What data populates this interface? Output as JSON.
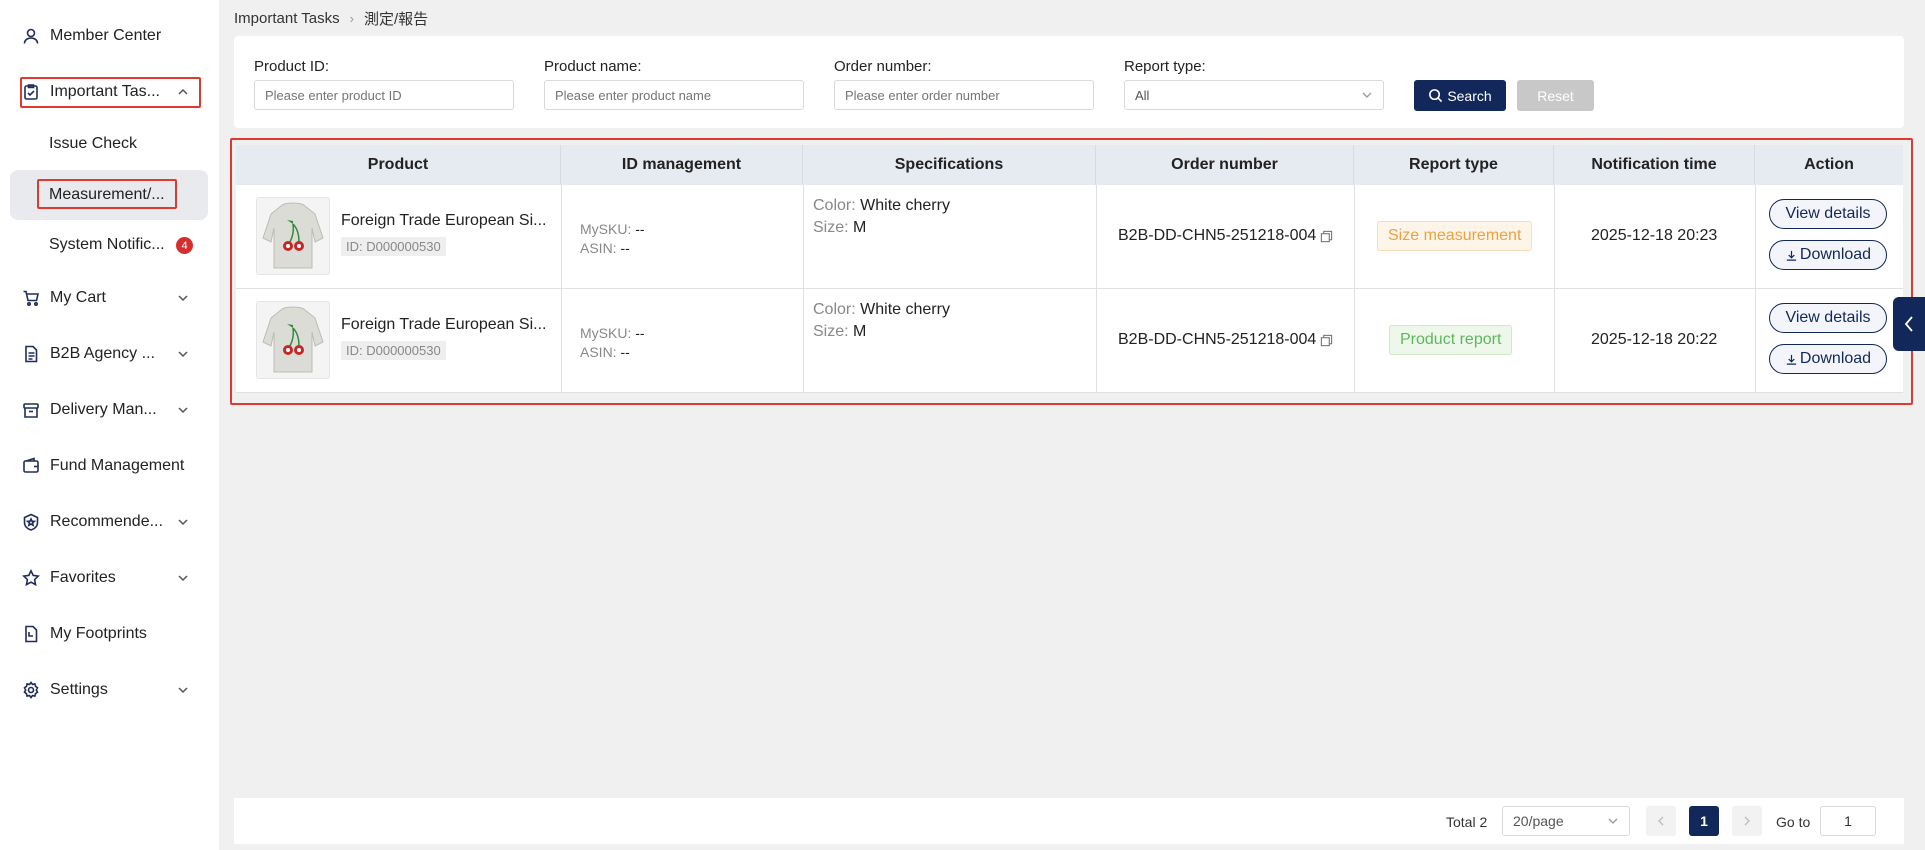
{
  "sidebar": {
    "items": [
      {
        "label": "Member Center",
        "icon": "user-icon"
      },
      {
        "label": "Important Tas...",
        "icon": "clipboard-check-icon"
      },
      {
        "label": "My Cart",
        "icon": "cart-icon"
      },
      {
        "label": "B2B Agency ...",
        "icon": "document-icon"
      },
      {
        "label": "Delivery Man...",
        "icon": "box-icon"
      },
      {
        "label": "Fund Management",
        "icon": "wallet-icon"
      },
      {
        "label": "Recommende...",
        "icon": "shield-star-icon"
      },
      {
        "label": "Favorites",
        "icon": "star-icon"
      },
      {
        "label": "My Footprints",
        "icon": "footprint-icon"
      },
      {
        "label": "Settings",
        "icon": "gear-icon"
      }
    ],
    "sub_items": [
      {
        "label": "Issue Check"
      },
      {
        "label": "Measurement/..."
      },
      {
        "label": "System Notific...",
        "badge": "4"
      }
    ]
  },
  "breadcrumb": {
    "parent": "Important Tasks",
    "current": "測定/報告"
  },
  "filters": {
    "product_id": {
      "label": "Product ID:",
      "placeholder": "Please enter product ID"
    },
    "product_name": {
      "label": "Product name:",
      "placeholder": "Please enter product name"
    },
    "order_number": {
      "label": "Order number:",
      "placeholder": "Please enter order number"
    },
    "report_type": {
      "label": "Report type:",
      "value": "All"
    },
    "search_label": "Search",
    "reset_label": "Reset"
  },
  "table": {
    "headers": [
      "Product",
      "ID management",
      "Specifications",
      "Order number",
      "Report type",
      "Notification time",
      "Action"
    ],
    "rows": [
      {
        "product_name": "Foreign Trade European Si...",
        "product_id": "ID: D000000530",
        "mysku_label": "MySKU:",
        "mysku": "--",
        "asin_label": "ASIN:",
        "asin": "--",
        "color_label": "Color:",
        "color": "White cherry",
        "size_label": "Size:",
        "size": "M",
        "order_number": "B2B-DD-CHN5-251218-004",
        "report_type": "Size measurement",
        "notification_time": "2025-12-18 20:23",
        "view_label": "View details",
        "download_label": "Download"
      },
      {
        "product_name": "Foreign Trade European Si...",
        "product_id": "ID: D000000530",
        "mysku_label": "MySKU:",
        "mysku": "--",
        "asin_label": "ASIN:",
        "asin": "--",
        "color_label": "Color:",
        "color": "White cherry",
        "size_label": "Size:",
        "size": "M",
        "order_number": "B2B-DD-CHN5-251218-004",
        "report_type": "Product report",
        "notification_time": "2025-12-18 20:22",
        "view_label": "View details",
        "download_label": "Download"
      }
    ]
  },
  "colors": {
    "primary": "#13285a",
    "size_tag_text": "#f0a040",
    "size_tag_bg": "#fdf5e8",
    "report_tag_text": "#5cb85c",
    "report_tag_bg": "#eef8ea",
    "highlight_border": "#e03a2f",
    "badge": "#d32f2f"
  },
  "pagination": {
    "total": "Total 2",
    "page_size": "20/page",
    "current_page": "1",
    "goto_label": "Go to",
    "goto_value": "1"
  }
}
